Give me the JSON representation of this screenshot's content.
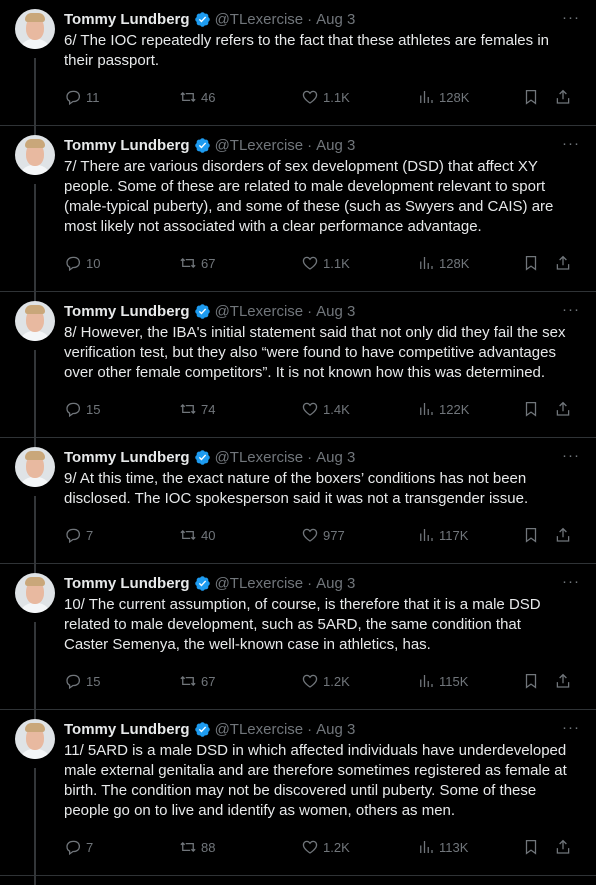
{
  "tweets": [
    {
      "name": "Tommy Lundberg",
      "handle": "@TLexercise",
      "date": "Aug 3",
      "text": "6/ The IOC repeatedly refers to the fact that these athletes are females in their passport.",
      "replies": "11",
      "retweets": "46",
      "likes": "1.1K",
      "views": "128K"
    },
    {
      "name": "Tommy Lundberg",
      "handle": "@TLexercise",
      "date": "Aug 3",
      "text": "7/ There are various disorders of sex development (DSD) that affect XY people. Some of these are related to male development relevant to sport (male-typical puberty), and some of these (such as Swyers and CAIS) are most likely not associated with a clear performance advantage.",
      "replies": "10",
      "retweets": "67",
      "likes": "1.1K",
      "views": "128K"
    },
    {
      "name": "Tommy Lundberg",
      "handle": "@TLexercise",
      "date": "Aug 3",
      "text": "8/ However, the IBA's initial statement said that not only did they fail the sex verification test, but they also “were found to have competitive advantages over other female competitors”. It is not known how this was determined.",
      "replies": "15",
      "retweets": "74",
      "likes": "1.4K",
      "views": "122K"
    },
    {
      "name": "Tommy Lundberg",
      "handle": "@TLexercise",
      "date": "Aug 3",
      "text": "9/ At this time, the exact nature of the boxers’ conditions has not been disclosed. The IOC spokesperson said it was not a transgender issue.",
      "replies": "7",
      "retweets": "40",
      "likes": "977",
      "views": "117K"
    },
    {
      "name": "Tommy Lundberg",
      "handle": "@TLexercise",
      "date": "Aug 3",
      "text": "10/ The current assumption, of course, is therefore that it is a male DSD related to male development, such as 5ARD, the same condition that Caster Semenya, the well-known case in athletics, has.",
      "replies": "15",
      "retweets": "67",
      "likes": "1.2K",
      "views": "115K"
    },
    {
      "name": "Tommy Lundberg",
      "handle": "@TLexercise",
      "date": "Aug 3",
      "text": "11/ 5ARD is a male DSD in which affected individuals have underdeveloped male external genitalia and are therefore sometimes registered as female at birth. The condition may not be discovered until puberty. Some of these people go on to live and identify as women, others as men.",
      "replies": "7",
      "retweets": "88",
      "likes": "1.2K",
      "views": "113K"
    }
  ],
  "ui": {
    "dot": "·",
    "more": "···",
    "badge_color": "#1d9bf0",
    "icons": [
      "reply-icon",
      "retweet-icon",
      "like-icon",
      "views-icon",
      "bookmark-icon",
      "share-icon"
    ]
  }
}
